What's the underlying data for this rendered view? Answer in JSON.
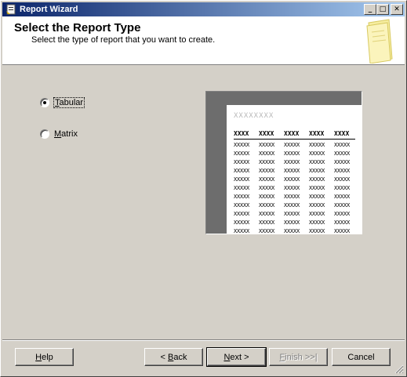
{
  "window": {
    "title": "Report Wizard",
    "minimize_glyph": "_",
    "maximize_glyph": "□",
    "close_glyph": "✕"
  },
  "header": {
    "title": "Select the Report Type",
    "subtitle": "Select the type of report that you want to create."
  },
  "options": {
    "selected": "Tabular",
    "tabular": {
      "first": "T",
      "rest": "abular"
    },
    "matrix": {
      "first": "M",
      "rest": "atrix"
    }
  },
  "preview": {
    "title": "XXXXXXXX",
    "headers": [
      "XXXX",
      "XXXX",
      "XXXX",
      "XXXX",
      "XXXX"
    ],
    "cell": "XXXXX",
    "rows": 11
  },
  "buttons": {
    "help": {
      "first": "H",
      "rest": "elp",
      "enabled": true
    },
    "back": {
      "pre": "< ",
      "first": "B",
      "rest": "ack",
      "enabled": true
    },
    "next": {
      "first": "N",
      "rest": "ext >",
      "enabled": true,
      "default": true
    },
    "finish": {
      "first": "F",
      "rest": "inish >>|",
      "enabled": false
    },
    "cancel": {
      "label": "Cancel",
      "enabled": true
    }
  }
}
